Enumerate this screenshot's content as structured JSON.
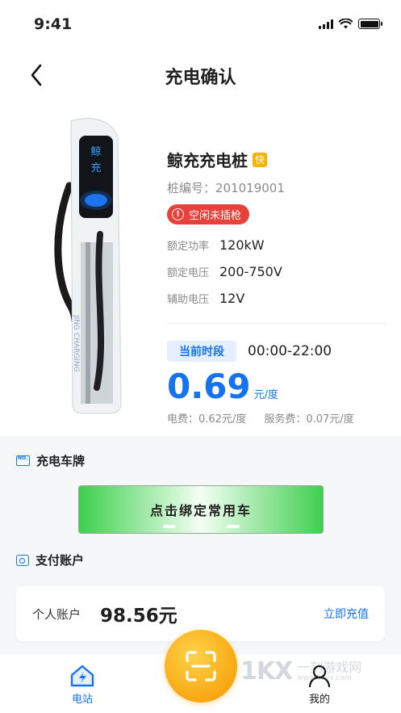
{
  "status_bar": {
    "time": "9:41"
  },
  "nav": {
    "title": "充电确认"
  },
  "charger": {
    "brand_chars": [
      "鲸",
      "充"
    ],
    "side_text": "JING CHARGING",
    "name": "鲸充充电桩",
    "fast_badge": "快",
    "pile_no": "桩编号：201019001",
    "status": "空闲未插枪",
    "specs": [
      {
        "label": "额定功率",
        "value": "120kW"
      },
      {
        "label": "额定电压",
        "value": "200-750V"
      },
      {
        "label": "辅助电压",
        "value": "12V"
      }
    ]
  },
  "pricing": {
    "period_label": "当前时段",
    "period_time": "00:00-22:00",
    "price": "0.69",
    "price_unit": "元/度",
    "electric_fee": "电费：0.62元/度",
    "service_fee": "服务费：0.07元/度"
  },
  "plate_section": {
    "title": "充电车牌",
    "bind_button": "点击绑定常用车"
  },
  "account_section": {
    "title": "支付账户",
    "account_label": "个人账户",
    "balance": "98.56元",
    "topup": "立即充值"
  },
  "tabbar": {
    "station": "电站",
    "mine": "我的"
  },
  "watermark": {
    "mark": "1KX",
    "text": "一刻游戏网",
    "url": "www.1kyx.com"
  },
  "colors": {
    "accent": "#1673ef",
    "status_red": "#e8413b",
    "scan_orange": "#f7a812",
    "fast_yellow": "#f4b400"
  }
}
